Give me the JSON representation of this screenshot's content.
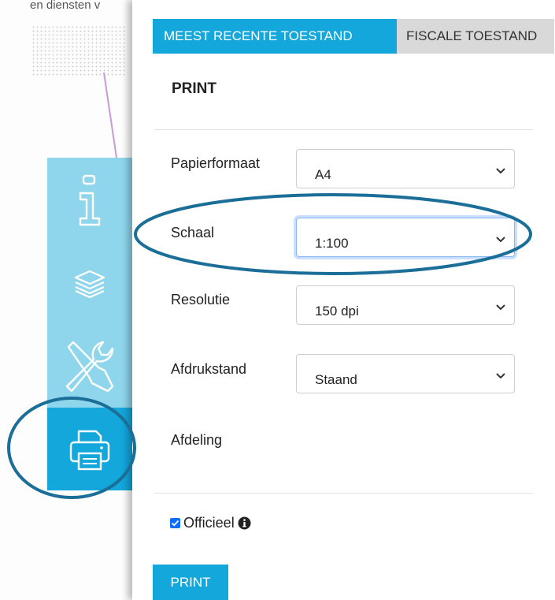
{
  "map": {
    "partial_text": "en diensten v"
  },
  "toolbar": {
    "items": [
      "info-icon",
      "layers-icon",
      "tools-icon",
      "printer-icon"
    ],
    "active": "printer-icon"
  },
  "tabs": [
    {
      "label": "MEEST RECENTE TOESTAND",
      "active": true
    },
    {
      "label": "FISCALE TOESTAND",
      "active": false
    }
  ],
  "panel": {
    "title": "PRINT"
  },
  "form": {
    "paper": {
      "label": "Papierformaat",
      "value": "A4"
    },
    "scale": {
      "label": "Schaal",
      "value": "1:100"
    },
    "resolution": {
      "label": "Resolutie",
      "value": "150 dpi"
    },
    "orientation": {
      "label": "Afdrukstand",
      "value": "Staand"
    },
    "department": {
      "label": "Afdeling"
    }
  },
  "official": {
    "label": "Officieel",
    "checked": true
  },
  "print_button": {
    "label": "PRINT"
  },
  "colors": {
    "accent": "#13a7dc",
    "toolbar_light": "#8fd6ec",
    "annotation": "#1a6e97",
    "map_line": "#c79bd6"
  }
}
